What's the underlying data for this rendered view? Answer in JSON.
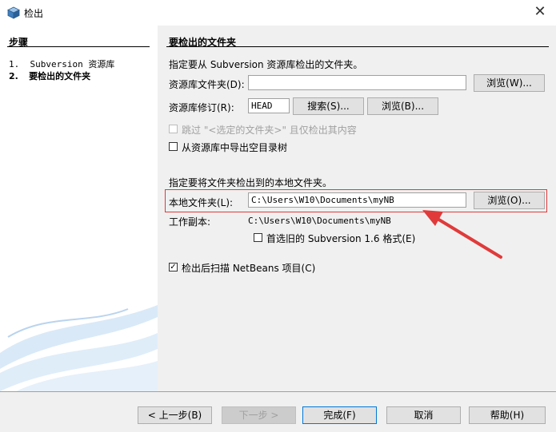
{
  "window": {
    "title": "检出",
    "close_glyph": "✕"
  },
  "steps": {
    "title": "步骤",
    "items": [
      {
        "num": "1.",
        "label": "Subversion 资源库"
      },
      {
        "num": "2.",
        "label": "要检出的文件夹"
      }
    ]
  },
  "main": {
    "title": "要检出的文件夹",
    "repo_instruction": "指定要从 Subversion 资源库检出的文件夹。",
    "repo_folder_label": "资源库文件夹(D):",
    "repo_folder_value": "",
    "browse_repo_label": "浏览(W)...",
    "revision_label": "资源库修订(R):",
    "revision_value": "HEAD",
    "search_label": "搜索(S)...",
    "browse_revision_label": "浏览(B)...",
    "skip_selected_label": "跳过 \"<选定的文件夹>\" 且仅检出其内容",
    "export_empty_label": "从资源库中导出空目录树",
    "local_instruction": "指定要将文件夹检出到的本地文件夹。",
    "local_folder_label": "本地文件夹(L):",
    "local_folder_value": "C:\\Users\\W10\\Documents\\myNB",
    "browse_local_label": "浏览(O)...",
    "working_copy_label": "工作副本:",
    "working_copy_value": "C:\\Users\\W10\\Documents\\myNB",
    "prefer_old_label": "首选旧的 Subversion 1.6 格式(E)",
    "scan_after_label": "检出后扫描 NetBeans 项目(C)",
    "scan_after_checked": "✓",
    "annotation_color": "#e03a3a"
  },
  "footer": {
    "back_label": "< 上一步(B)",
    "next_label": "下一步 >",
    "finish_label": "完成(F)",
    "cancel_label": "取消",
    "help_label": "帮助(H)"
  }
}
